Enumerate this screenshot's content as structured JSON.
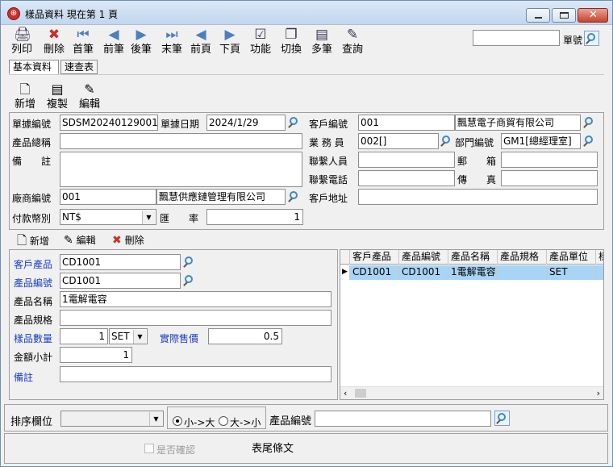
{
  "window": {
    "title": "樣品資料 現在第 1 頁"
  },
  "toolbar": [
    {
      "label": "列印",
      "icon": "printer-icon",
      "glyph": "🖨"
    },
    {
      "label": "刪除",
      "icon": "delete-icon",
      "glyph": "✖"
    },
    {
      "label": "首筆",
      "icon": "first-icon",
      "glyph": "⏮"
    },
    {
      "label": "前筆",
      "icon": "prev-icon",
      "glyph": "◀"
    },
    {
      "label": "後筆",
      "icon": "next-icon",
      "glyph": "▶"
    },
    {
      "label": "末筆",
      "icon": "last-icon",
      "glyph": "⏭"
    },
    {
      "label": "前頁",
      "icon": "prev-page-icon",
      "glyph": "◀"
    },
    {
      "label": "下頁",
      "icon": "next-page-icon",
      "glyph": "▶"
    },
    {
      "label": "功能",
      "icon": "function-icon",
      "glyph": "☑"
    },
    {
      "label": "切換",
      "icon": "switch-icon",
      "glyph": "❐"
    },
    {
      "label": "多筆",
      "icon": "multi-icon",
      "glyph": "▤"
    },
    {
      "label": "查詢",
      "icon": "query-icon",
      "glyph": "✎"
    }
  ],
  "search": {
    "label": "單號",
    "value": ""
  },
  "tabs": [
    {
      "label": "基本資料"
    },
    {
      "label": "速查表"
    }
  ],
  "subtoolbar": [
    {
      "label": "新增",
      "icon": "new-doc-icon"
    },
    {
      "label": "複製",
      "icon": "copy-doc-icon"
    },
    {
      "label": "編輯",
      "icon": "edit-doc-icon"
    }
  ],
  "header": {
    "doc_no_label": "單據編號",
    "doc_no": "SDSM20240129001",
    "doc_date_label": "單據日期",
    "doc_date": "2024/1/29",
    "product_name_label": "產品總稱",
    "product_name": "",
    "remark_label": "備　　註",
    "remark": "",
    "vendor_no_label": "廠商編號",
    "vendor_no": "001",
    "vendor_name": "飄慧供應鏈管理有限公司",
    "currency_label": "付款幣別",
    "currency": "NT$",
    "rate_label": "匯　　率",
    "rate": "1",
    "customer_no_label": "客戶編號",
    "customer_no": "001",
    "customer_name": "飄慧電子商貿有限公司",
    "sales_label": "業 務 員",
    "sales": "002[]",
    "dept_label": "部門編號",
    "dept": "GM1[總經理室]",
    "contact_label": "聯繫人員",
    "contact": "",
    "mail_label": "郵　　箱",
    "mail": "",
    "phone_label": "聯繫電話",
    "phone": "",
    "fax_label": "傳　　真",
    "fax": "",
    "address_label": "客戶地址",
    "address": ""
  },
  "detail_toolbar": [
    {
      "label": "新增"
    },
    {
      "label": "編輯"
    },
    {
      "label": "刪除"
    }
  ],
  "detail": {
    "cust_product_label": "客戶產品",
    "cust_product": "CD1001",
    "product_no_label": "產品編號",
    "product_no": "CD1001",
    "product_name_label": "產品名稱",
    "product_name": "1電解電容",
    "spec_label": "產品規格",
    "spec": "",
    "qty_label": "樣品數量",
    "qty": "1",
    "unit": "SET",
    "price_label": "實際售價",
    "price": "0.5",
    "subtotal_label": "金額小計",
    "subtotal": "1",
    "note_label": "備註",
    "note": ""
  },
  "grid": {
    "columns": [
      "客戶產品",
      "產品編號",
      "產品名稱",
      "產品規格",
      "產品單位",
      "樣"
    ],
    "rows": [
      [
        "CD1001",
        "CD1001",
        "1電解電容",
        "",
        "SET",
        ""
      ]
    ]
  },
  "footer": {
    "sort_label": "排序欄位",
    "sort_value": "",
    "asc_label": "小->大",
    "desc_label": "大->小",
    "product_no_label": "產品編號",
    "product_no_value": "",
    "confirm_label": "是否確認",
    "footer_text": "表尾條文"
  }
}
